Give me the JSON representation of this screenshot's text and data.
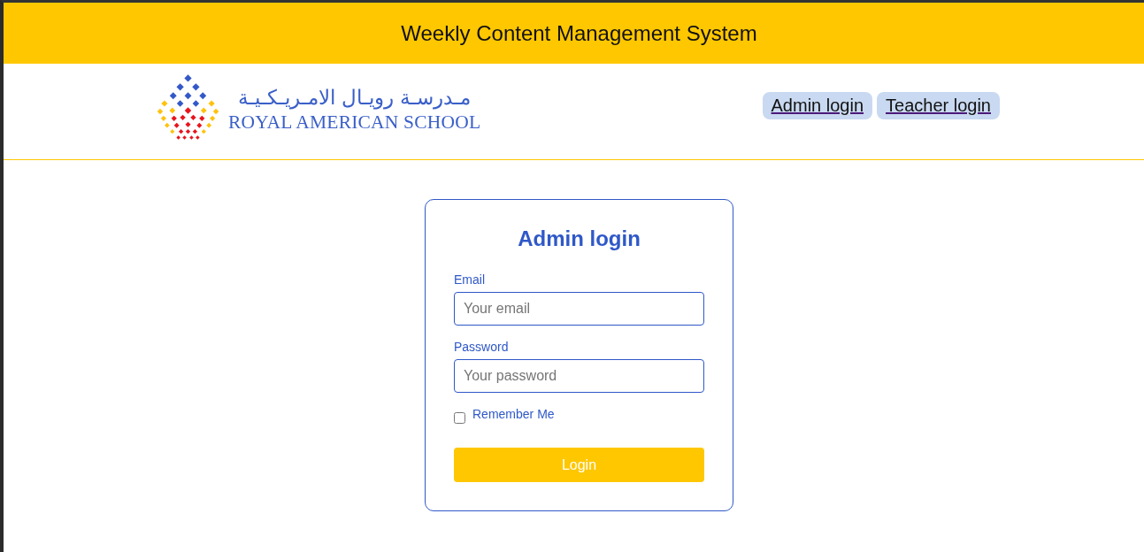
{
  "header": {
    "title": "Weekly Content Management System"
  },
  "logo": {
    "arabic_name": "مـدرسـة رويـال الامـريـكـيـة",
    "name": "ROYAL AMERICAN SCHOOL"
  },
  "nav": {
    "links": [
      {
        "label": "Admin login"
      },
      {
        "label": "Teacher login"
      }
    ]
  },
  "login_form": {
    "title": "Admin login",
    "fields": [
      {
        "label": "Email",
        "placeholder": "Your email"
      },
      {
        "label": "Password",
        "placeholder": "Your password"
      }
    ],
    "remember": {
      "label": "Remember Me",
      "checked": false
    },
    "submit": "Login"
  }
}
